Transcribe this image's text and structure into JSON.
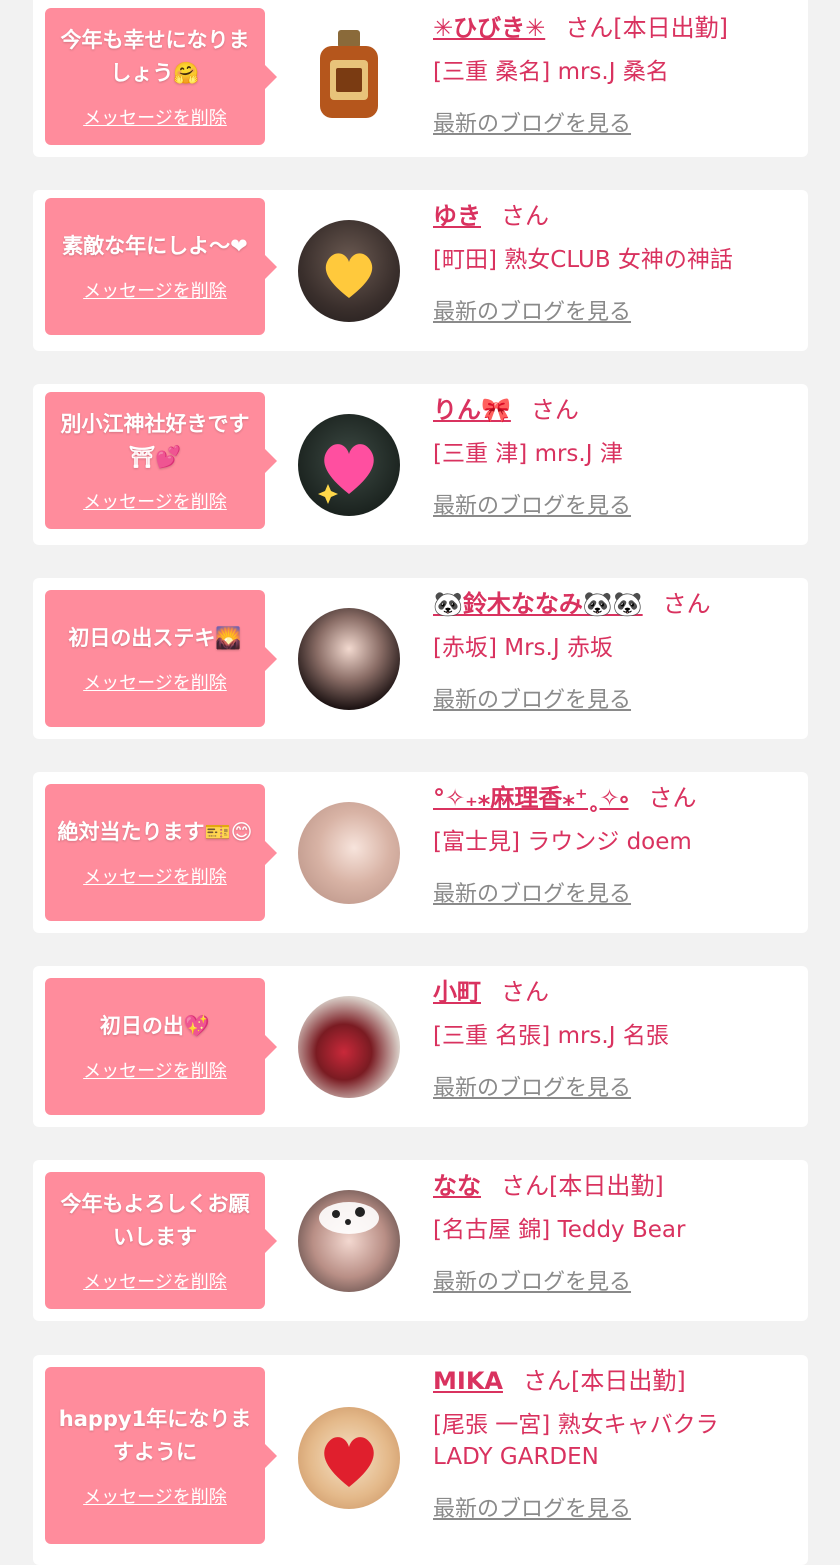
{
  "cards": [
    {
      "message": "今年も幸せになりましょう🤗",
      "delete": "メッセージを削除",
      "name": "✳︎ひびき✳︎",
      "suffix": "さん[本日出勤]",
      "shop": "[三重 桑名] mrs.J 桑名",
      "blog": "最新のブログを見る"
    },
    {
      "message": "素敵な年にしよ〜❤",
      "delete": "メッセージを削除",
      "name": "ゆき",
      "suffix": "さん",
      "shop": "[町田] 熟女CLUB 女神の神話",
      "blog": "最新のブログを見る"
    },
    {
      "message": "別小江神社好きです⛩💕",
      "delete": "メッセージを削除",
      "name": "りん🎀",
      "suffix": "さん",
      "shop": "[三重 津] mrs.J 津",
      "blog": "最新のブログを見る"
    },
    {
      "message": "初日の出ステキ🌄",
      "delete": "メッセージを削除",
      "name": "🐼鈴木ななみ🐼🐼",
      "suffix": "さん",
      "shop": "[赤坂] Mrs.J 赤坂",
      "blog": "最新のブログを見る"
    },
    {
      "message": "絶対当たります🎫😊",
      "delete": "メッセージを削除",
      "name": "°✧₊⁎麻理香⁎⁺˳✧༚",
      "suffix": "さん",
      "shop": "[富士見] ラウンジ doem",
      "blog": "最新のブログを見る"
    },
    {
      "message": "初日の出💖",
      "delete": "メッセージを削除",
      "name": "小町",
      "suffix": "さん",
      "shop": "[三重 名張] mrs.J 名張",
      "blog": "最新のブログを見る"
    },
    {
      "message": "今年もよろしくお願いします",
      "delete": "メッセージを削除",
      "name": "なな",
      "suffix": "さん[本日出勤]",
      "shop": "[名古屋 錦] Teddy Bear",
      "blog": "最新のブログを見る"
    },
    {
      "message": "happy1年になりますように",
      "delete": "メッセージを削除",
      "name": "MIKA",
      "suffix": "さん[本日出勤]",
      "shop": "[尾張 一宮] 熟女キャバクラ LADY GARDEN",
      "blog": "最新のブログを見る"
    }
  ],
  "colors": {
    "accent": "#d9325f",
    "bubble": "#ff8c9c",
    "link_gray": "#8a8a8a",
    "background": "#f2f2f2"
  }
}
